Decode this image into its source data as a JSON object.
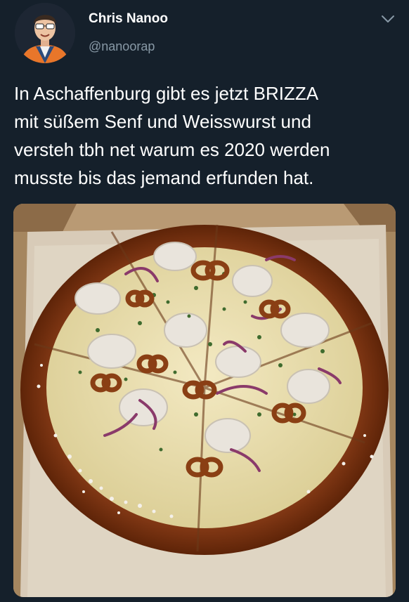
{
  "author": {
    "display_name": "Chris Nanoo",
    "handle": "@nanoorap",
    "avatar_icon": "user-avatar-photo"
  },
  "menu_icon": "chevron-down-icon",
  "tweet": {
    "text_lines": [
      "In Aschaffenburg gibt es jetzt BRIZZA",
      "mit süßem Senf und Weisswurst und",
      "versteh tbh net warum es 2020 werden",
      "musste bis das jemand erfunden hat."
    ]
  },
  "media": {
    "subject": "pizza-photo"
  },
  "colors": {
    "background": "#15202b",
    "text": "#ffffff",
    "secondary_text": "#8899a6"
  }
}
